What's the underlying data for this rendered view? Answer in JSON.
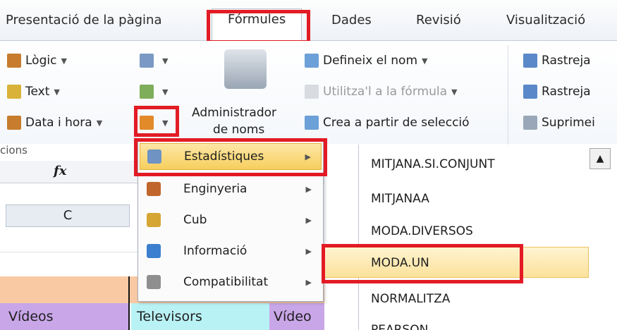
{
  "tabs": [
    {
      "label": "Presentació de la pàgina"
    },
    {
      "label": "Fórmules",
      "active": true
    },
    {
      "label": "Dades"
    },
    {
      "label": "Revisió"
    },
    {
      "label": "Visualització"
    }
  ],
  "ribbon": {
    "logic": "Lògic",
    "text": "Text",
    "datetime": "Data i hora",
    "name_manager_line1": "Administrador",
    "name_manager_line2": "de noms",
    "define_name": "Defineix el nom",
    "use_in_formula": "Utilitza'l a la fórmula",
    "create_from_selection": "Crea a partir de selecció",
    "trace1": "Rastreja",
    "trace2": "Rastreja",
    "remove": "Suprimei",
    "group_label": "cions"
  },
  "grid": {
    "fx": "fx",
    "column_c": "C",
    "cell_videos": "Vídeos",
    "cell_televisors": "Televisors",
    "cell_video2": "Vídeo"
  },
  "categories_menu": [
    {
      "label": "Estadístiques",
      "highlighted": true
    },
    {
      "label": "Enginyeria"
    },
    {
      "label": "Cub"
    },
    {
      "label": "Informació"
    },
    {
      "label": "Compatibilitat"
    }
  ],
  "functions": [
    "MITJANA.SI.CONJUNT",
    "MITJANAA",
    "MODA.DIVERSOS",
    "MODA.UN",
    "NORMALITZA",
    "PEARSON"
  ],
  "colors": {
    "accent_red": "#e21b24",
    "highlight": "#f6cf5d"
  }
}
